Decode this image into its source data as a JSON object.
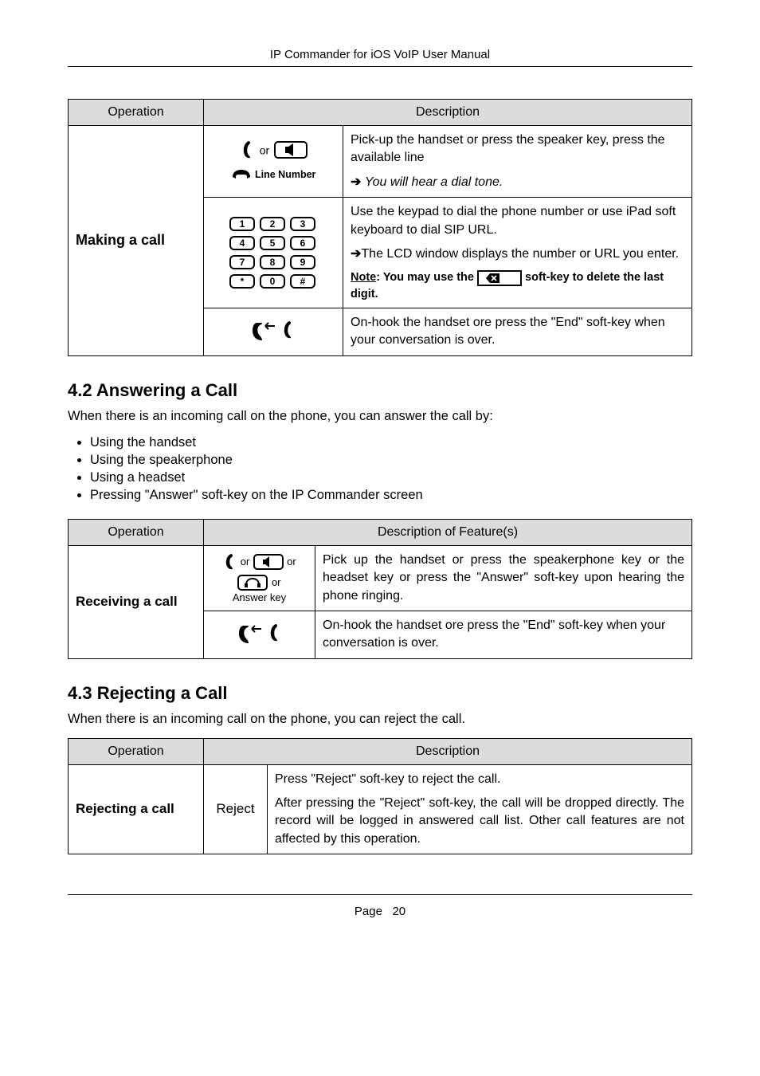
{
  "header": {
    "title": "IP Commander for iOS VoIP User Manual"
  },
  "table1": {
    "head": {
      "op": "Operation",
      "desc": "Description"
    },
    "opLabel": "Making a call",
    "row1": {
      "orWord": "or",
      "lineNumber": "Line Number",
      "desc1": "Pick-up the handset or press the speaker key, press the available line",
      "desc2": "You will hear a dial tone."
    },
    "row2": {
      "d1": "Use the keypad to dial the phone number or use iPad soft keyboard to dial SIP URL.",
      "d2": "The LCD window displays the number or URL you enter.",
      "noteLead": "Note",
      "noteA": ": You may use the ",
      "noteB": " soft-key to delete the last digit."
    },
    "row3": {
      "desc": "On-hook the handset ore press the \"End\" soft-key when your conversation is over."
    }
  },
  "sec42": {
    "heading": "4.2  Answering a Call",
    "intro": "When there is an incoming call on the phone, you can answer the call by:",
    "bullets": [
      "Using the handset",
      "Using the speakerphone",
      "Using a headset",
      "Pressing \"Answer\" soft-key on the IP Commander screen"
    ],
    "head": {
      "op": "Operation",
      "desc": "Description of Feature(s)"
    },
    "opLabel": "Receiving a call",
    "row1": {
      "orWord": "or",
      "orWord2": "or",
      "answerKey": "Answer key",
      "desc": "Pick up the handset or press the speakerphone key or the headset key or press the \"Answer\" soft-key upon hearing the phone ringing."
    },
    "row2": {
      "desc": "On-hook the handset ore press the \"End\" soft-key when your conversation is over."
    }
  },
  "sec43": {
    "heading": "4.3  Rejecting a Call",
    "intro": "When there is an incoming call on the phone, you can reject the call.",
    "head": {
      "op": "Operation",
      "desc": "Description"
    },
    "opLabel": "Rejecting a call",
    "rejectLabel": "Reject",
    "d1": "Press \"Reject\" soft-key to reject the call.",
    "d2": "After pressing the \"Reject\" soft-key, the call will be dropped directly. The record will be logged in answered call list. Other call features are not affected by this operation."
  },
  "footer": {
    "page": "Page",
    "num": "20"
  }
}
